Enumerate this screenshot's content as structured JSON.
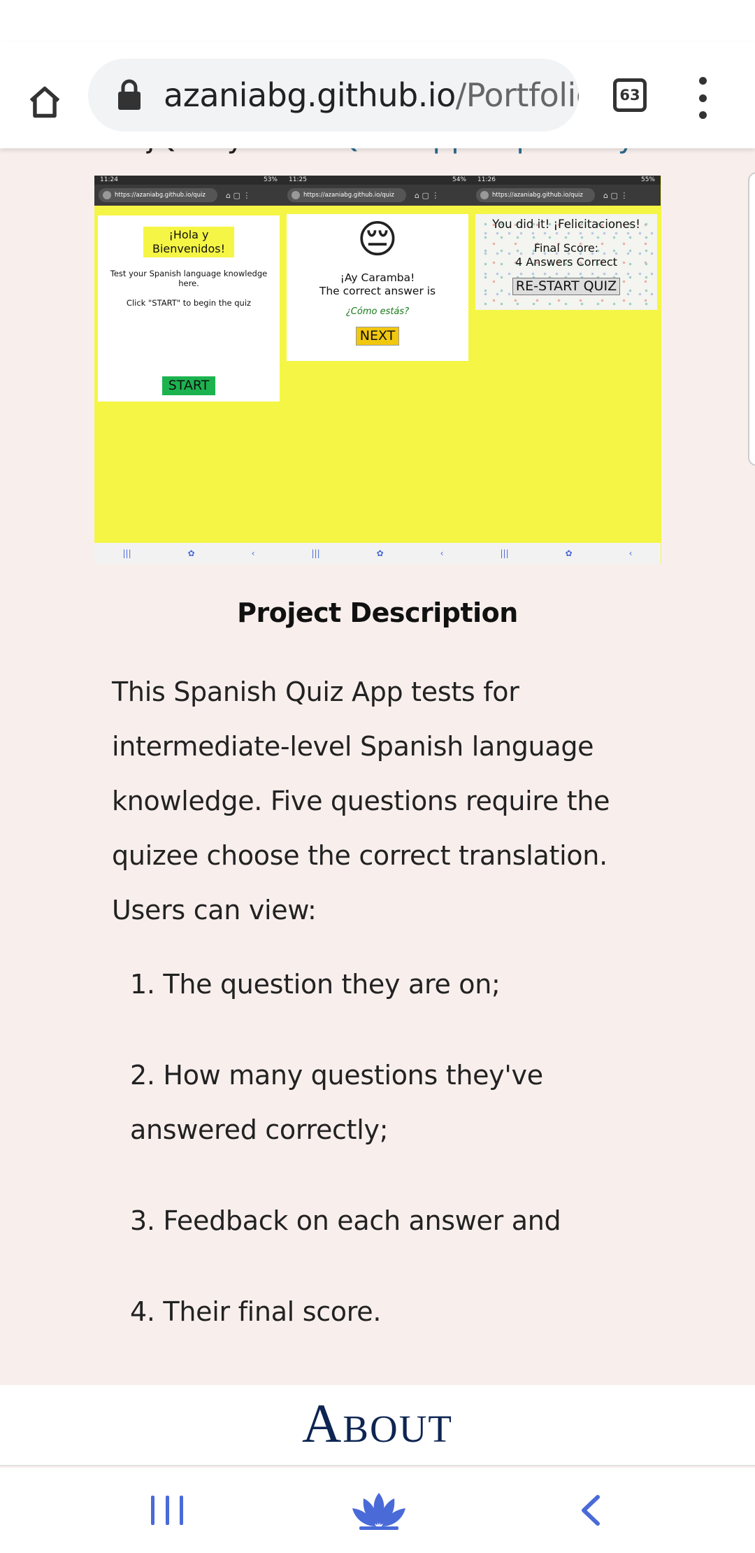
{
  "browser": {
    "url_host": "azaniabg.github.io",
    "url_path": "/Portfolio",
    "tab_count": "63"
  },
  "scrolled_line": {
    "prefix": "jQuery. View",
    "link_text": "Quiz App Repository"
  },
  "screenshots": {
    "phone1": {
      "time": "11:24",
      "battery": "53%",
      "url": "https://azaniabg.github.io/quiz",
      "greeting": "¡Hola y Bienvenidos!",
      "line1": "Test your Spanish language knowledge here.",
      "line2": "Click \"START\" to begin the quiz",
      "button": "START"
    },
    "phone2": {
      "time": "11:25",
      "battery": "54%",
      "url": "https://azaniabg.github.io/quiz",
      "emoji": "😔",
      "exclaim": "¡Ay Caramba!",
      "correct_label": "The correct answer is",
      "answer": "¿Cómo estás?",
      "button": "NEXT"
    },
    "phone3": {
      "time": "11:26",
      "battery": "55%",
      "url": "https://azaniabg.github.io/quiz",
      "congrats": "You did it! ¡Felicitaciones!",
      "score_label": "Final Score:",
      "score_value": "4 Answers Correct",
      "button": "RE-START QUIZ"
    }
  },
  "description": {
    "heading": "Project Description",
    "paragraph": "This Spanish Quiz App tests for intermediate-level Spanish language knowledge. Five questions require the quizee choose the correct translation. Users can view:",
    "items": [
      "1. The question they are on;",
      "2. How many questions they've answered correctly;",
      "3. Feedback on each answer and",
      "4. Their final score."
    ]
  },
  "about_banner": "About",
  "colors": {
    "page_bg": "#f8efed",
    "quiz_yellow": "#f5f545",
    "start_green": "#1cb34f",
    "next_gold": "#f2c80f",
    "about_navy": "#0e2552",
    "nav_blue": "#4a6ad8"
  },
  "icons": {
    "home": "home-icon",
    "lock": "lock-icon",
    "menu": "more-vert-icon",
    "recents": "recent-apps-icon",
    "lotus": "lotus-home-icon",
    "back": "back-chevron-icon"
  }
}
